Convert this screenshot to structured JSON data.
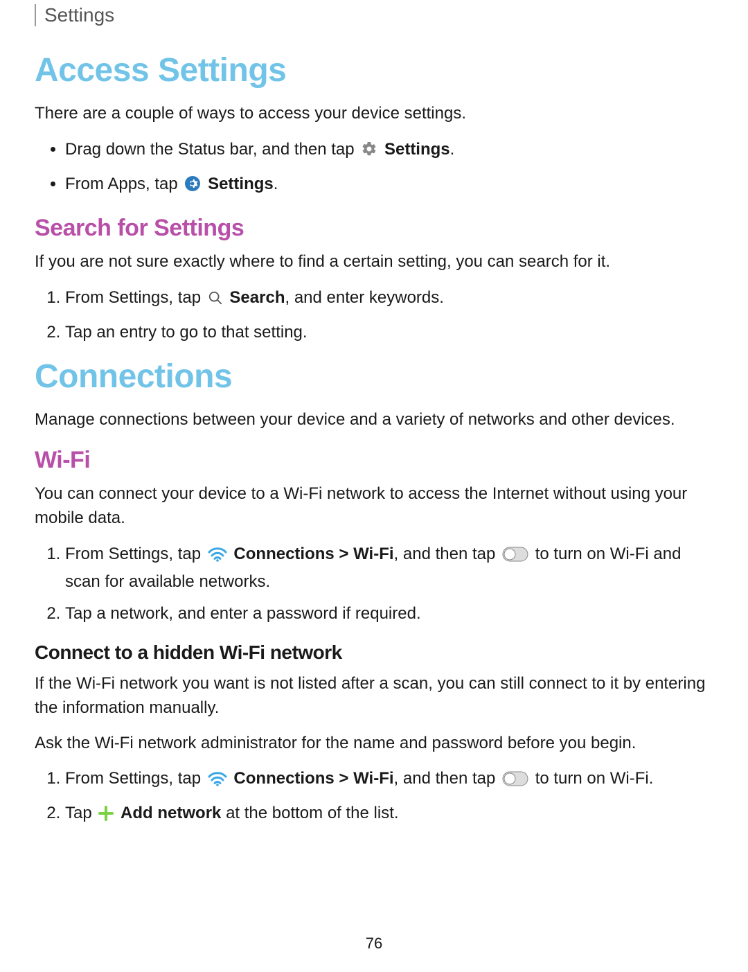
{
  "header": "Settings",
  "h1_access": "Access Settings",
  "p_access_intro": "There are a couple of ways to access your device settings.",
  "bullets_access": {
    "b1_pre": "Drag down the Status bar, and then tap ",
    "b1_bold": "Settings",
    "b1_post": ".",
    "b2_pre": "From Apps, tap ",
    "b2_bold": "Settings",
    "b2_post": "."
  },
  "h2_search": "Search for Settings",
  "p_search_intro": "If you are not sure exactly where to find a certain setting, you can search for it.",
  "steps_search": {
    "s1_pre": "From Settings, tap ",
    "s1_bold": "Search",
    "s1_post": ", and enter keywords.",
    "s2": "Tap an entry to go to that setting."
  },
  "h1_connections": "Connections",
  "p_connections_intro": "Manage connections between your device and a variety of networks and other devices.",
  "h2_wifi": "Wi-Fi",
  "p_wifi_intro": "You can connect your device to a Wi-Fi network to access the Internet without using your mobile data.",
  "steps_wifi": {
    "s1_pre": "From Settings, tap ",
    "s1_bold": "Connections > Wi-Fi",
    "s1_mid": ", and then tap ",
    "s1_post": " to turn on Wi-Fi and scan for available networks.",
    "s2": "Tap a network, and enter a password if required."
  },
  "h3_hidden": "Connect to a hidden Wi-Fi network",
  "p_hidden_intro": "If the Wi-Fi network you want is not listed after a scan, you can still connect to it by entering the information manually.",
  "p_hidden_ask": "Ask the Wi-Fi network administrator for the name and password before you begin.",
  "steps_hidden": {
    "s1_pre": "From Settings, tap ",
    "s1_bold": "Connections > Wi-Fi",
    "s1_mid": ", and then tap ",
    "s1_post": " to turn on Wi-Fi.",
    "s2_pre": "Tap ",
    "s2_bold": "Add network",
    "s2_post": " at the bottom of the list."
  },
  "page_number": "76"
}
